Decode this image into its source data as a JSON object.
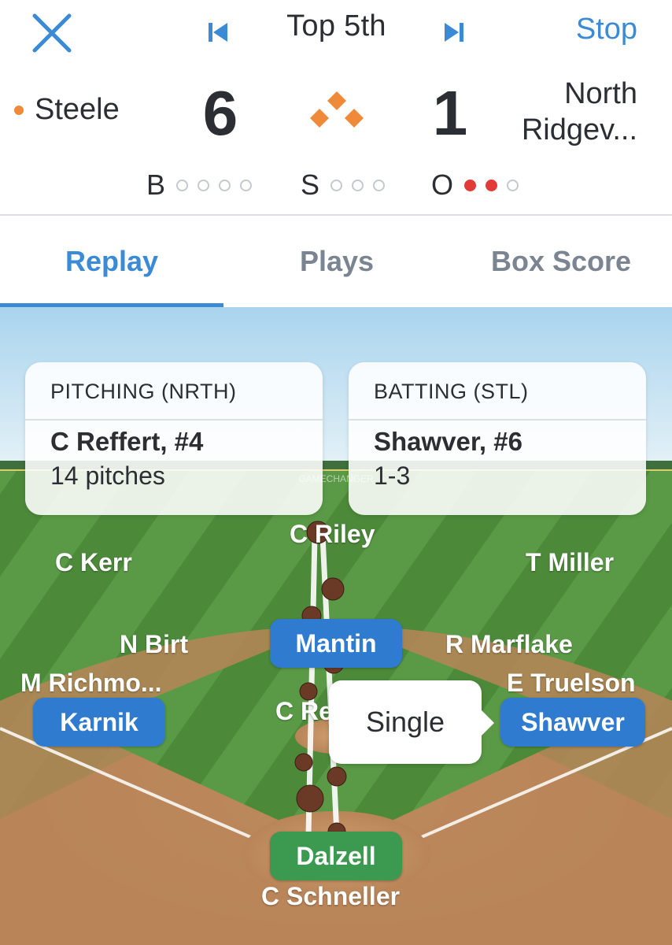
{
  "header": {
    "inning": "Top 5th",
    "stop_label": "Stop",
    "home_team": "Steele",
    "home_score": "6",
    "away_team_line1": "North",
    "away_team_line2": "Ridgev...",
    "away_score": "1",
    "count": {
      "balls_label": "B",
      "strikes_label": "S",
      "outs_label": "O",
      "balls": 0,
      "strikes": 0,
      "outs": 2
    }
  },
  "tabs": [
    {
      "label": "Replay",
      "active": true
    },
    {
      "label": "Plays",
      "active": false
    },
    {
      "label": "Box Score",
      "active": false
    }
  ],
  "pitching": {
    "title": "PITCHING (NRTH)",
    "name": "C Reffert, #4",
    "stat": "14 pitches"
  },
  "batting": {
    "title": "BATTING (STL)",
    "name": "Shawver, #6",
    "stat": "1-3"
  },
  "watermark": "GAMECHANGER",
  "fielders": {
    "cf": "C Riley",
    "lf": "C Kerr",
    "rf": "T Miller",
    "ss": "N Birt",
    "second": "R Marflake",
    "third": "M Richmo...",
    "first": "E Truelson",
    "pitcher": "C Re",
    "catcher": "C Schneller"
  },
  "runners": {
    "second_base": "Mantin",
    "third_base": "Karnik",
    "first_base": "Shawver",
    "batter": "Dalzell"
  },
  "play_result": "Single",
  "colors": {
    "accent": "#3a8ad6",
    "home_dot": "#ef8a3a",
    "out_dot": "#e23b37",
    "runner_pill": "#2f7bd0",
    "batter_pill": "#3b9a4f"
  }
}
